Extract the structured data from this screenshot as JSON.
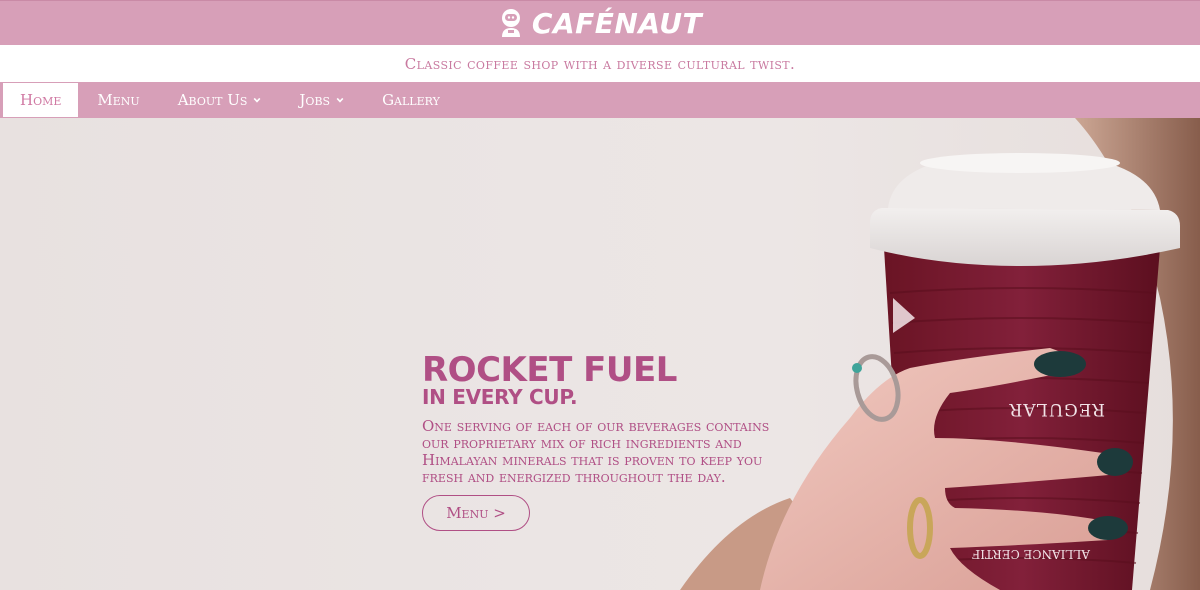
{
  "brand": {
    "name": "CAFÉNAUT",
    "tagline": "Classic coffee shop with a diverse cultural twist."
  },
  "nav": {
    "items": [
      {
        "label": "Home",
        "active": true
      },
      {
        "label": "Menu"
      },
      {
        "label": "About Us",
        "dropdown": true
      },
      {
        "label": "Jobs",
        "dropdown": true
      },
      {
        "label": "Gallery"
      }
    ]
  },
  "hero": {
    "headline": "ROCKET FUEL",
    "subheadline": "IN EVERY CUP.",
    "body": "One serving of each of our beverages contains our proprietary mix of rich ingredients and Himalayan minerals that is proven to keep you fresh and energized throughout the day.",
    "cta_label": "Menu >",
    "cup_text": "REGULAR"
  },
  "colors": {
    "brand_pink": "#d79fb8",
    "accent_text": "#b04f85",
    "cup_red": "#7e1a2c"
  }
}
